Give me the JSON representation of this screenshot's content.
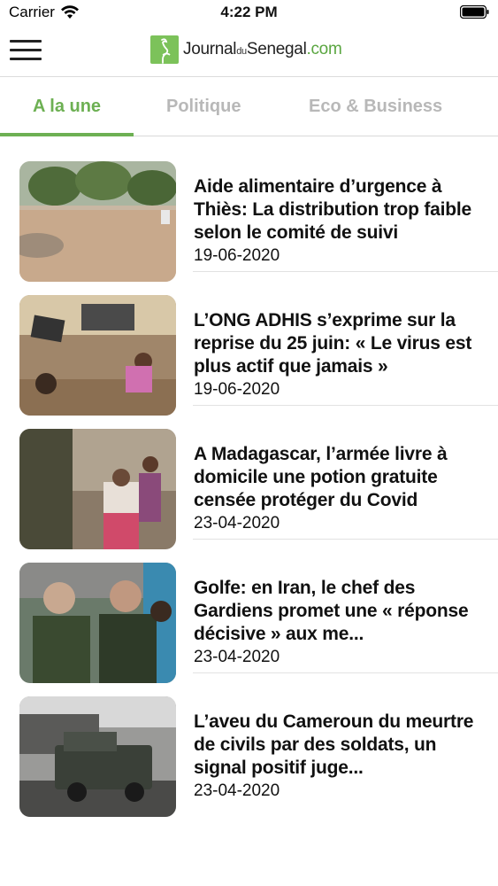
{
  "status_bar": {
    "carrier": "Carrier",
    "time": "4:22 PM"
  },
  "header": {
    "logo_part1": "Journal",
    "logo_part2": "du",
    "logo_part3": "Senegal",
    "logo_part4": ".com"
  },
  "tabs": [
    {
      "label": "A la une",
      "active": true
    },
    {
      "label": "Politique",
      "active": false
    },
    {
      "label": "Eco & Business",
      "active": false
    }
  ],
  "articles": [
    {
      "title": "Aide alimentaire d’urgence à Thiès: La distribution trop faible selon le comité de suivi",
      "date": "19-06-2020"
    },
    {
      "title": "L’ONG ADHIS s’exprime sur la reprise du 25 juin: « Le virus est plus actif que jamais »",
      "date": "19-06-2020"
    },
    {
      "title": "A Madagascar, l’armée livre à domicile une potion gratuite censée protéger du Covid",
      "date": "23-04-2020"
    },
    {
      "title": "Golfe: en Iran, le chef des Gardiens promet une « réponse décisive » aux me...",
      "date": "23-04-2020"
    },
    {
      "title": "L’aveu du Cameroun du meurtre de civils par des soldats, un signal positif juge...",
      "date": "23-04-2020"
    }
  ],
  "colors": {
    "accent": "#6db053",
    "inactive_tab": "#b8b8b8"
  }
}
